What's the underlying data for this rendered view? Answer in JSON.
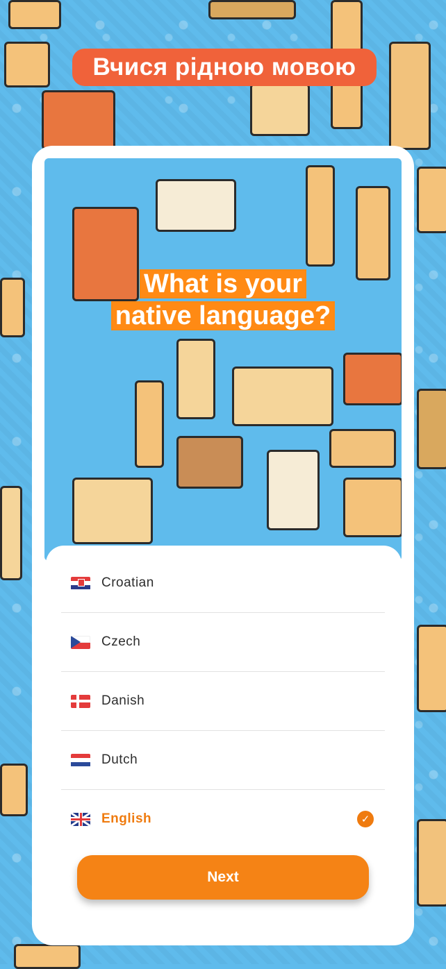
{
  "top_banner": {
    "text": "Вчися рідною мовою"
  },
  "hero": {
    "line1": "What is your",
    "line2": "native language?"
  },
  "languages": [
    {
      "label": "Croatian",
      "flag": "croatia-flag-icon",
      "selected": false
    },
    {
      "label": "Czech",
      "flag": "czech-flag-icon",
      "selected": false
    },
    {
      "label": "Danish",
      "flag": "denmark-flag-icon",
      "selected": false
    },
    {
      "label": "Dutch",
      "flag": "netherlands-flag-icon",
      "selected": false
    },
    {
      "label": "English",
      "flag": "uk-flag-icon",
      "selected": true
    }
  ],
  "next_button": {
    "label": "Next"
  },
  "colors": {
    "accent": "#f58315",
    "background": "#5fbbec",
    "selected_text": "#ef7b0f",
    "banner": "#f0623a"
  }
}
